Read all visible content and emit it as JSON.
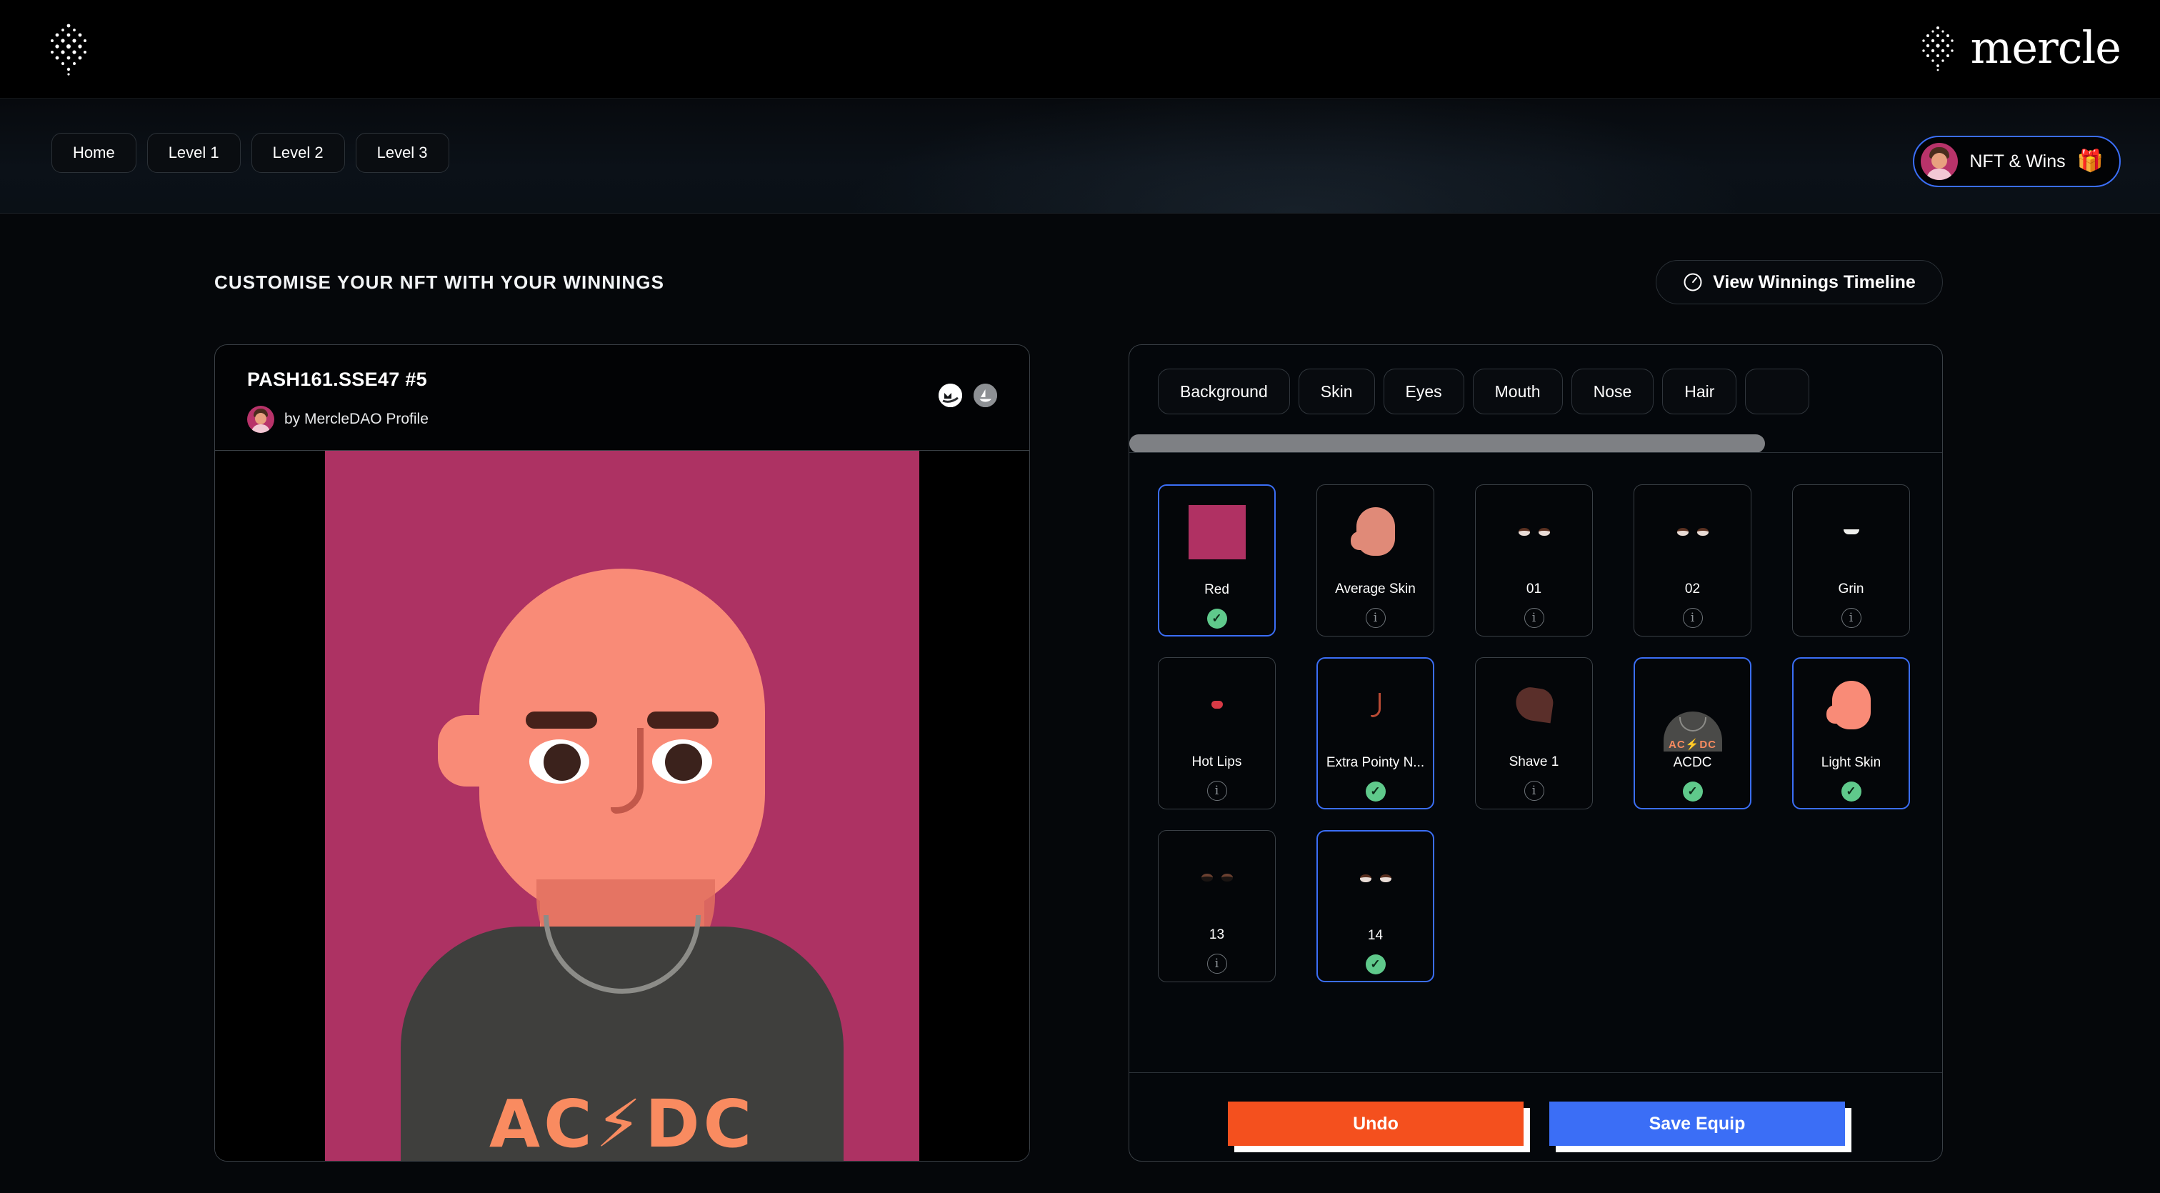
{
  "brand": {
    "name": "mercle",
    "logo_icon": "mercle-dot-logo"
  },
  "nav": {
    "pills": [
      {
        "label": "Home",
        "name": "home"
      },
      {
        "label": "Level 1",
        "name": "level-1"
      },
      {
        "label": "Level 2",
        "name": "level-2"
      },
      {
        "label": "Level 3",
        "name": "level-3"
      }
    ],
    "nft_wins": {
      "label": "NFT & Wins",
      "icon": "gift-icon",
      "gift_glyph": "🎁"
    }
  },
  "main": {
    "section_title": "CUSTOMISE YOUR NFT WITH YOUR WINNINGS",
    "timeline_button": {
      "label": "View Winnings Timeline",
      "icon": "clock-icon"
    }
  },
  "nft_card": {
    "title": "PASH161.SSE47 #5",
    "by": "by MercleDAO Profile",
    "links": [
      {
        "name": "magiceden-link",
        "icon": "magiceden-icon"
      },
      {
        "name": "opensea-link",
        "icon": "opensea-icon"
      }
    ],
    "art": {
      "background_color": "#ad3263",
      "skin_color": "#f98b77",
      "shirt_color": "#3f3f3d",
      "shirt_text": "AC⚡DC"
    }
  },
  "customiser": {
    "tabs": [
      {
        "label": "Background",
        "name": "background"
      },
      {
        "label": "Skin",
        "name": "skin"
      },
      {
        "label": "Eyes",
        "name": "eyes"
      },
      {
        "label": "Mouth",
        "name": "mouth"
      },
      {
        "label": "Nose",
        "name": "nose"
      },
      {
        "label": "Hair",
        "name": "hair"
      },
      {
        "label": "",
        "name": "clipped-tab"
      }
    ],
    "scrollbar": {
      "orientation": "horizontal",
      "thumb_fraction": 0.78
    },
    "items": [
      {
        "label": "Red",
        "thumb": "color-swatch-red",
        "state": "equipped",
        "badge": "check-icon"
      },
      {
        "label": "Average Skin",
        "thumb": "head-skin-average",
        "state": "locked",
        "badge": "info-icon"
      },
      {
        "label": "01",
        "thumb": "eyes-01",
        "state": "locked",
        "badge": "info-icon"
      },
      {
        "label": "02",
        "thumb": "eyes-02",
        "state": "locked",
        "badge": "info-icon"
      },
      {
        "label": "Grin",
        "thumb": "mouth-grin",
        "state": "locked",
        "badge": "info-icon"
      },
      {
        "label": "Hot Lips",
        "thumb": "mouth-hot-lips",
        "state": "locked",
        "badge": "info-icon"
      },
      {
        "label": "Extra Pointy N...",
        "thumb": "nose-extra-pointy",
        "state": "equipped",
        "badge": "check-icon"
      },
      {
        "label": "Shave 1",
        "thumb": "hair-shave-1",
        "state": "locked",
        "badge": "info-icon"
      },
      {
        "label": "ACDC",
        "thumb": "clothing-acdc",
        "state": "equipped",
        "badge": "check-icon"
      },
      {
        "label": "Light Skin",
        "thumb": "head-skin-light",
        "state": "equipped",
        "badge": "check-icon"
      },
      {
        "label": "13",
        "thumb": "eyes-13",
        "state": "locked",
        "badge": "info-icon"
      },
      {
        "label": "14",
        "thumb": "eyes-14",
        "state": "equipped",
        "badge": "check-icon"
      }
    ],
    "footer": {
      "undo_label": "Undo",
      "save_label": "Save Equip",
      "undo_color": "#f4501e",
      "save_color": "#3b6ef6"
    }
  }
}
